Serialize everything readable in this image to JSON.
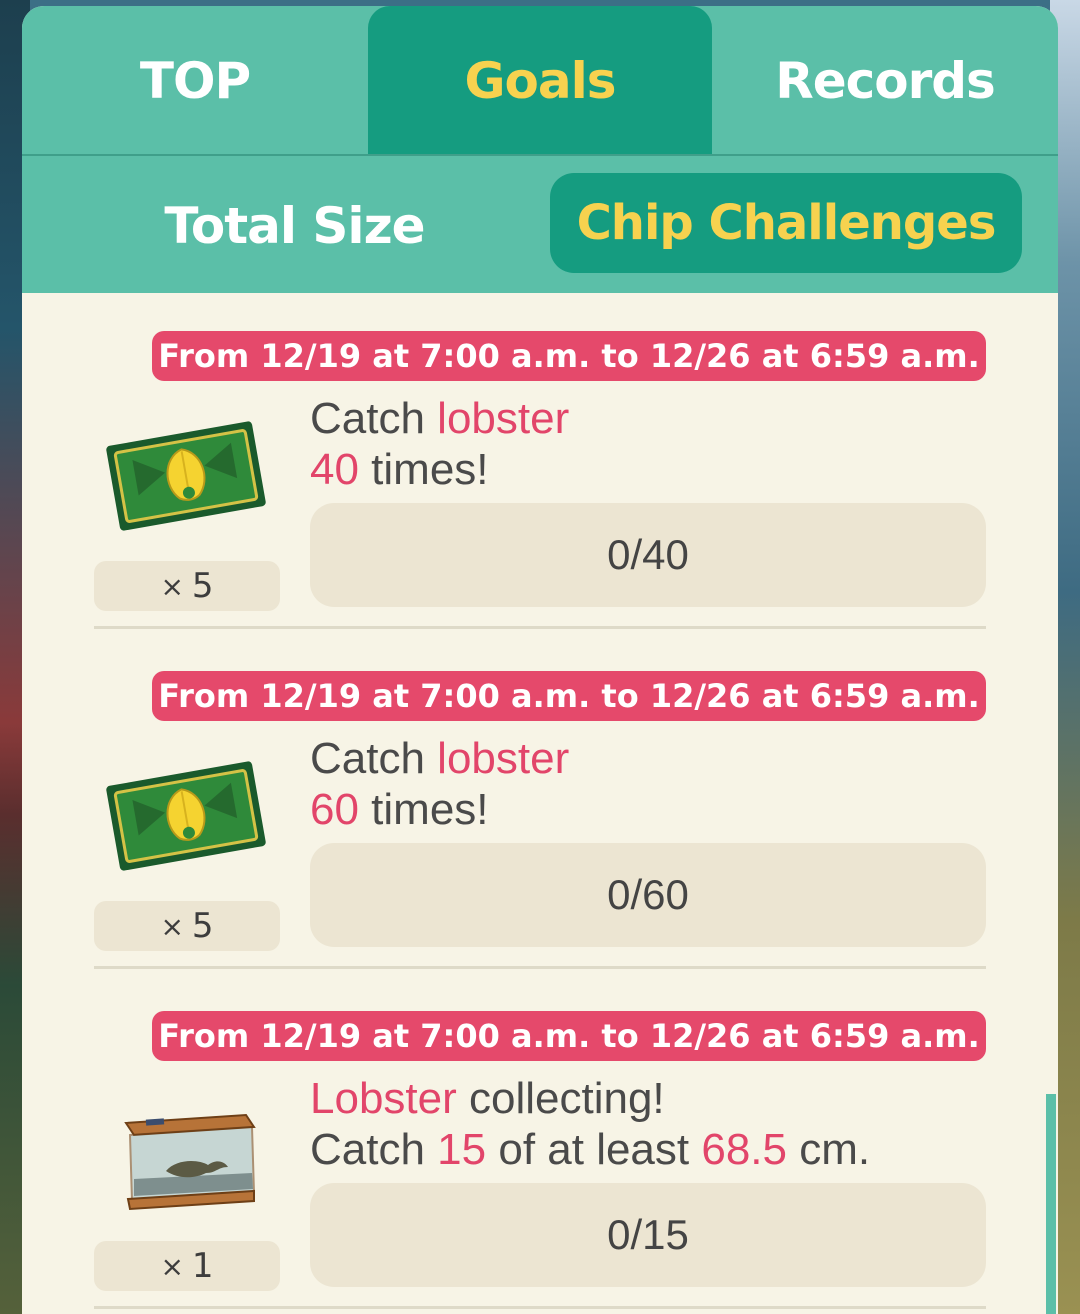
{
  "tabs": [
    {
      "label": "TOP",
      "active": false
    },
    {
      "label": "Goals",
      "active": true
    },
    {
      "label": "Records",
      "active": false
    }
  ],
  "subtabs": [
    {
      "label": "Total Size",
      "active": false
    },
    {
      "label": "Chip Challenges",
      "active": true
    }
  ],
  "challenges": [
    {
      "period": "From 12/19 at 7:00 a.m. to 12/26 at 6:59 a.m.",
      "line1": {
        "pre": "Catch ",
        "hl": "lobster",
        "post": ""
      },
      "line2": {
        "hl1": "40",
        "mid": " times!",
        "hl2": "",
        "post": ""
      },
      "progress_text": "0/40",
      "progress_fraction": 0,
      "reward_icon": "leaf-ticket-icon",
      "reward_qty_prefix": "×",
      "reward_qty": "5"
    },
    {
      "period": "From 12/19 at 7:00 a.m. to 12/26 at 6:59 a.m.",
      "line1": {
        "pre": "Catch ",
        "hl": "lobster",
        "post": ""
      },
      "line2": {
        "hl1": "60",
        "mid": " times!",
        "hl2": "",
        "post": ""
      },
      "progress_text": "0/60",
      "progress_fraction": 0,
      "reward_icon": "leaf-ticket-icon",
      "reward_qty_prefix": "×",
      "reward_qty": "5"
    },
    {
      "period": "From 12/19 at 7:00 a.m. to 12/26 at 6:59 a.m.",
      "line1": {
        "pre": "",
        "hl": "Lobster",
        "post": " collecting!"
      },
      "line2": {
        "pre": "Catch ",
        "hl1": "15",
        "mid": " of at least ",
        "hl2": "68.5",
        "post": " cm."
      },
      "progress_text": "0/15",
      "progress_fraction": 0,
      "reward_icon": "lobster-aquarium-icon",
      "reward_qty_prefix": "×",
      "reward_qty": "1"
    }
  ],
  "colors": {
    "tab_bar": "#5bbfa8",
    "tab_active": "#159c80",
    "active_text": "#f7d24f",
    "highlight": "#e2456a",
    "period_bg": "#e5496b",
    "panel_bg": "#f7f4e6"
  }
}
